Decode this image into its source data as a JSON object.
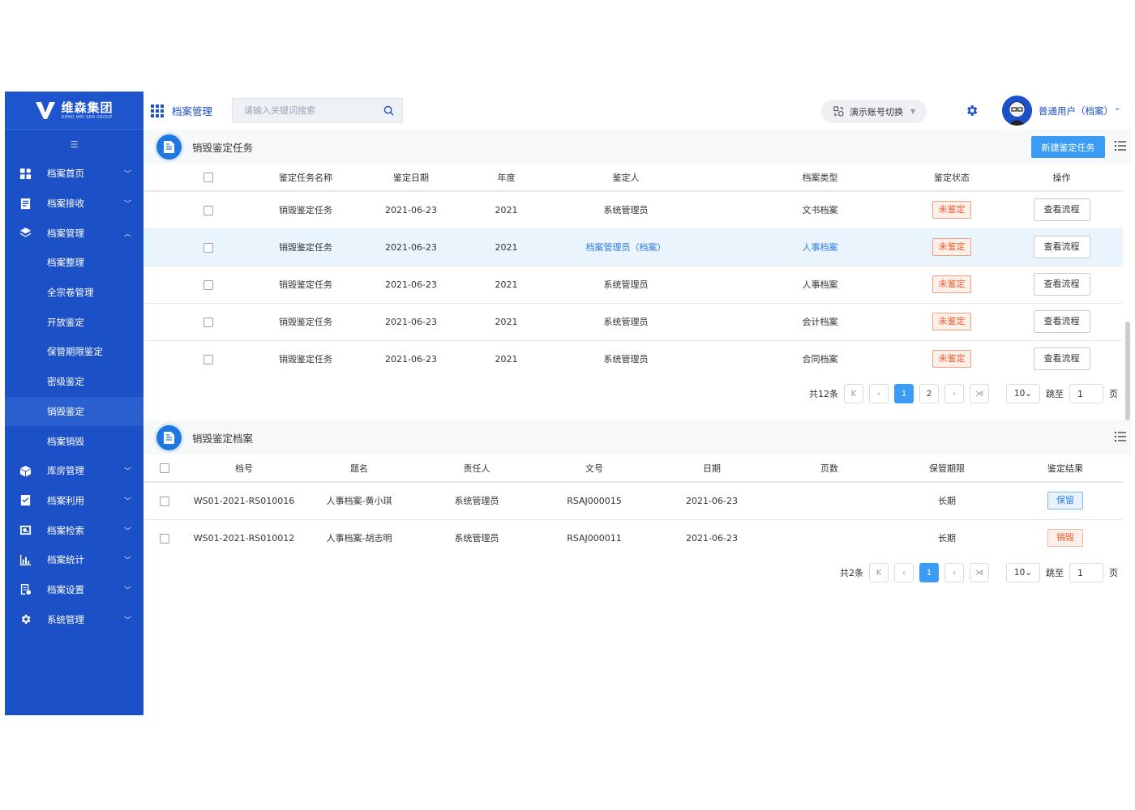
{
  "brand": {
    "name": "维森集团",
    "sub": "DEMO WEI SEN GROUP"
  },
  "header": {
    "app_name": "档案管理",
    "search_placeholder": "请输入关键词搜索",
    "switch_label": "演示账号切换",
    "user_name": "普通用户（档案）"
  },
  "sidebar": {
    "items": [
      {
        "label": "档案首页",
        "icon": "dashboard-icon"
      },
      {
        "label": "档案接收",
        "icon": "inbox-icon"
      },
      {
        "label": "档案管理",
        "icon": "layers-icon",
        "expanded": true,
        "children": [
          "档案整理",
          "全宗卷管理",
          "开放鉴定",
          "保管期限鉴定",
          "密级鉴定",
          "销毁鉴定",
          "档案销毁"
        ]
      },
      {
        "label": "库房管理",
        "icon": "cube-icon"
      },
      {
        "label": "档案利用",
        "icon": "checklist-icon"
      },
      {
        "label": "档案检索",
        "icon": "search-doc-icon"
      },
      {
        "label": "档案统计",
        "icon": "bar-chart-icon"
      },
      {
        "label": "档案设置",
        "icon": "settings-doc-icon"
      },
      {
        "label": "系统管理",
        "icon": "gear-icon"
      }
    ],
    "active_child": "销毁鉴定"
  },
  "tasks": {
    "title": "销毁鉴定任务",
    "new_button": "新建鉴定任务",
    "columns": [
      "鉴定任务名称",
      "鉴定日期",
      "年度",
      "鉴定人",
      "档案类型",
      "鉴定状态",
      "操作"
    ],
    "rows": [
      {
        "name": "销毁鉴定任务",
        "date": "2021-06-23",
        "year": "2021",
        "person": "系统管理员",
        "type": "文书档案",
        "status": "未鉴定",
        "action": "查看流程"
      },
      {
        "name": "销毁鉴定任务",
        "date": "2021-06-23",
        "year": "2021",
        "person": "档案管理员（档案）",
        "type": "人事档案",
        "status": "未鉴定",
        "action": "查看流程",
        "highlight": true
      },
      {
        "name": "销毁鉴定任务",
        "date": "2021-06-23",
        "year": "2021",
        "person": "系统管理员",
        "type": "人事档案",
        "status": "未鉴定",
        "action": "查看流程"
      },
      {
        "name": "销毁鉴定任务",
        "date": "2021-06-23",
        "year": "2021",
        "person": "系统管理员",
        "type": "会计档案",
        "status": "未鉴定",
        "action": "查看流程"
      },
      {
        "name": "销毁鉴定任务",
        "date": "2021-06-23",
        "year": "2021",
        "person": "系统管理员",
        "type": "合同档案",
        "status": "未鉴定",
        "action": "查看流程"
      }
    ],
    "pager": {
      "total": "共12条",
      "pages": [
        "1",
        "2"
      ],
      "current": "1",
      "size": "10",
      "jump_label": "跳至",
      "jump_value": "1",
      "page_unit": "页"
    }
  },
  "archives": {
    "title": "销毁鉴定档案",
    "columns": [
      "档号",
      "题名",
      "责任人",
      "文号",
      "日期",
      "页数",
      "保管期限",
      "鉴定结果"
    ],
    "rows": [
      {
        "code": "WS01-2021-RS010016",
        "title": "人事档案-黄小琪",
        "owner": "系统管理员",
        "doc_no": "RSAJ000015",
        "date": "2021-06-23",
        "pages": "",
        "period": "长期",
        "result": "保留"
      },
      {
        "code": "WS01-2021-RS010012",
        "title": "人事档案-胡志明",
        "owner": "系统管理员",
        "doc_no": "RSAJ000011",
        "date": "2021-06-23",
        "pages": "",
        "period": "长期",
        "result": "销毁"
      }
    ],
    "pager": {
      "total": "共2条",
      "pages": [
        "1"
      ],
      "current": "1",
      "size": "10",
      "jump_label": "跳至",
      "jump_value": "1",
      "page_unit": "页"
    }
  },
  "colors": {
    "primary": "#1c50c6",
    "accent": "#3b9cf5",
    "warn": "#ef5a2a"
  }
}
